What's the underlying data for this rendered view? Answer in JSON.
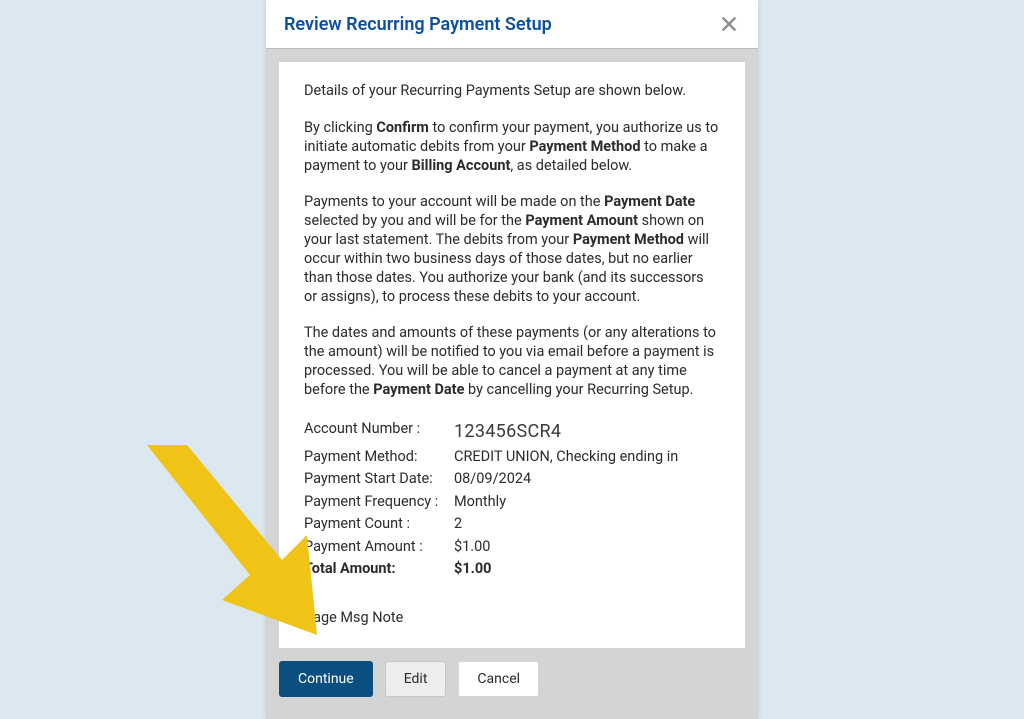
{
  "modal": {
    "title": "Review Recurring Payment Setup",
    "intro": "Details of your Recurring Payments Setup are shown below.",
    "para1_pre": "By clicking ",
    "para1_b1": "Confirm",
    "para1_mid1": " to confirm your payment, you authorize us to initiate automatic debits from your ",
    "para1_b2": "Payment Method",
    "para1_mid2": " to make a payment to your ",
    "para1_b3": "Billing Account",
    "para1_post": ", as detailed below.",
    "para2_pre": "Payments to your account will be made on the ",
    "para2_b1": "Payment Date",
    "para2_mid1": " selected by you and will be for the ",
    "para2_b2": "Payment Amount",
    "para2_mid2": " shown on your last statement. The debits from your ",
    "para2_b3": "Payment Method",
    "para2_post": " will occur within two business days of those dates, but no earlier than those dates. You authorize your bank (and its successors or assigns), to process these debits to your account.",
    "para3_pre": "The dates and amounts of these payments (or any alterations to the amount) will be notified to you via email before a payment is processed. You will be able to cancel a payment at any time before the ",
    "para3_b1": "Payment Date",
    "para3_post": " by cancelling your Recurring Setup.",
    "details": {
      "account_label": "Account Number :",
      "account_value": "123456SCR4",
      "method_label": "Payment Method:",
      "method_value": "CREDIT UNION, Checking ending in",
      "start_label": "Payment Start Date:",
      "start_value": "08/09/2024",
      "freq_label": "Payment Frequency :",
      "freq_value": "Monthly",
      "count_label": "Payment Count :",
      "count_value": "2",
      "amount_label": "Payment Amount :",
      "amount_value": "$1.00",
      "total_label": "Total Amount:",
      "total_value": "$1.00"
    },
    "page_note": "Page Msg Note",
    "buttons": {
      "continue": "Continue",
      "edit": "Edit",
      "cancel": "Cancel"
    }
  }
}
